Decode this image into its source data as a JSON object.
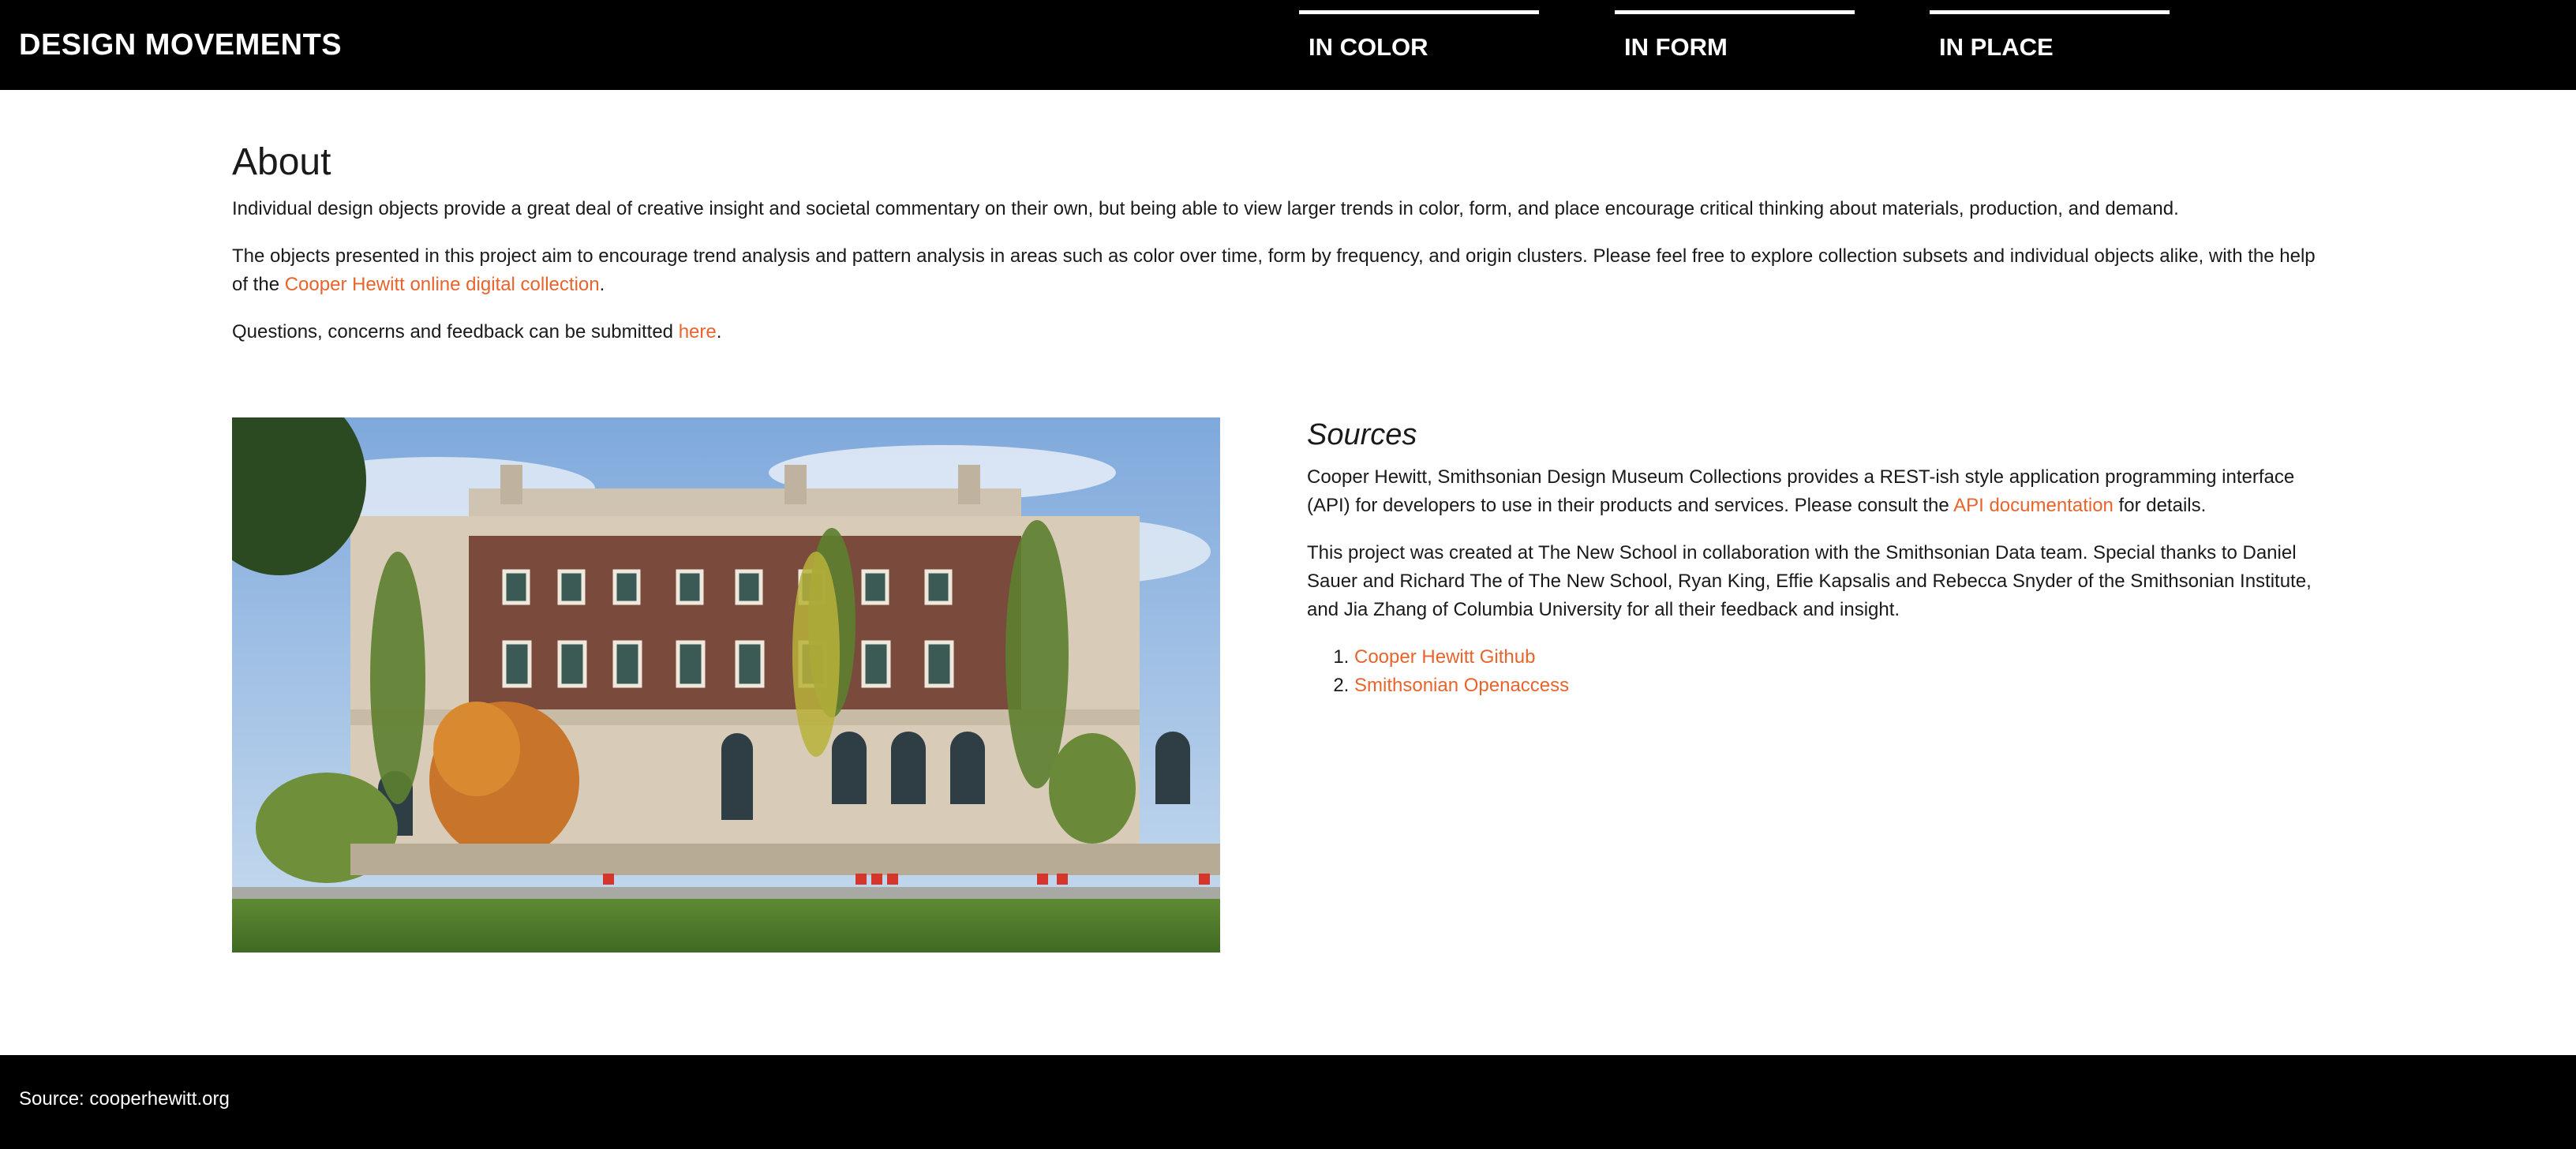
{
  "header": {
    "brand": "DESIGN MOVEMENTS",
    "nav": [
      {
        "label": "IN COLOR"
      },
      {
        "label": "IN FORM"
      },
      {
        "label": "IN PLACE"
      }
    ]
  },
  "about": {
    "title": "About",
    "p1": "Individual design objects provide a great deal of creative insight and societal commentary on their own, but being able to view larger trends in color, form, and place encourage critical thinking about materials, production, and demand.",
    "p2_before": "The objects presented in this project aim to encourage trend analysis and pattern analysis in areas such as color over time, form by frequency, and origin clusters. Please feel free to explore collection subsets and individual objects alike, with the help of the ",
    "p2_link": "Cooper Hewitt online digital collection",
    "p2_after": ".",
    "p3_before": "Questions, concerns and feedback can be submitted ",
    "p3_link": "here",
    "p3_after": "."
  },
  "sources": {
    "title": "Sources",
    "p1_before": "Cooper Hewitt, Smithsonian Design Museum Collections provides a REST-ish style application programming interface (API) for developers to use in their products and services. Please consult the ",
    "p1_link": "API documentation",
    "p1_after": " for details.",
    "p2": "This project was created at The New School in collaboration with the Smithsonian Data team. Special thanks to Daniel Sauer and Richard The of The New School, Ryan King, Effie Kapsalis and Rebecca Snyder of the Smithsonian Institute, and Jia Zhang of Columbia University for all their feedback and insight.",
    "links": [
      {
        "label": "Cooper Hewitt Github"
      },
      {
        "label": "Smithsonian Openaccess"
      }
    ]
  },
  "footer": {
    "text": "Source: cooperhewitt.org"
  },
  "colors": {
    "accent": "#e8642c",
    "bar": "#000000"
  }
}
